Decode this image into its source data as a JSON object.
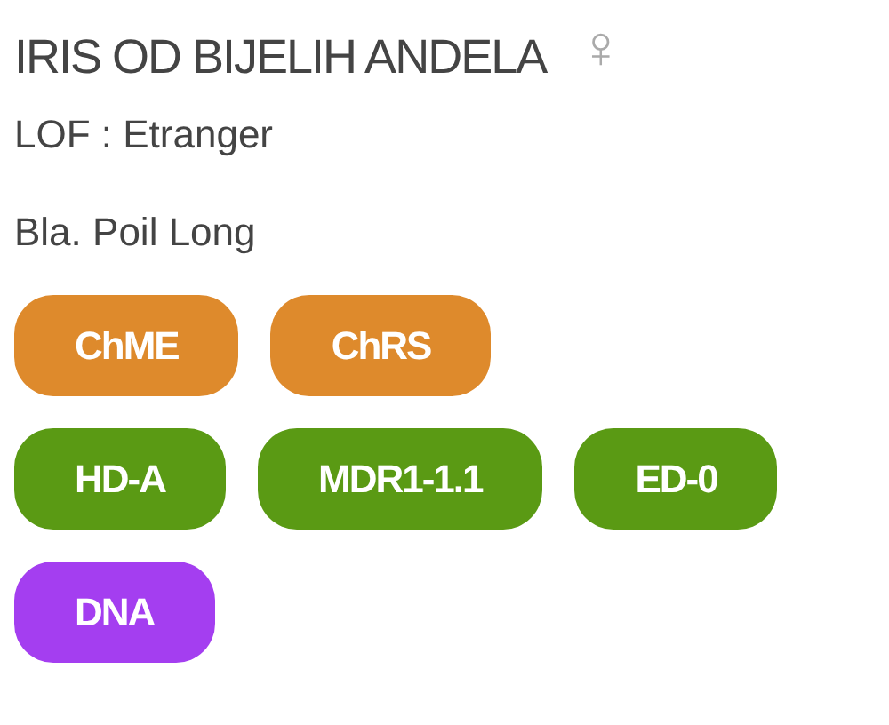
{
  "name": "IRIS OD BIJELIH ANDELA",
  "sex_symbol": "♀",
  "registry": "LOF : Etranger",
  "coat": "Bla. Poil Long",
  "badge_rows": [
    [
      {
        "label": "ChME",
        "color": "#de8a2c"
      },
      {
        "label": "ChRS",
        "color": "#de8a2c"
      }
    ],
    [
      {
        "label": "HD-A",
        "color": "#5a9a14"
      },
      {
        "label": "MDR1-1.1",
        "color": "#5a9a14"
      },
      {
        "label": "ED-0",
        "color": "#5a9a14"
      }
    ],
    [
      {
        "label": "DNA",
        "color": "#a43ef0"
      }
    ]
  ]
}
